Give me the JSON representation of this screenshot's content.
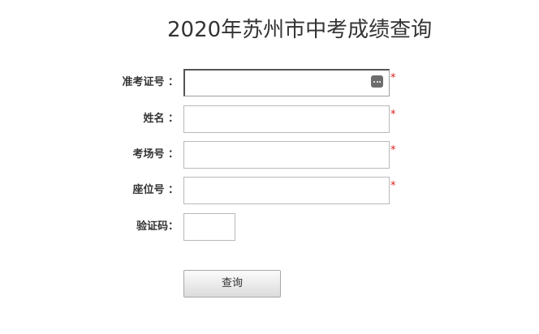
{
  "page": {
    "title": "2020年苏州市中考成绩查询"
  },
  "form": {
    "fields": [
      {
        "label": "准考证号 ：",
        "value": "",
        "required_mark": "*"
      },
      {
        "label": "姓名 ：",
        "value": "",
        "required_mark": "*"
      },
      {
        "label": "考场号 ：",
        "value": "",
        "required_mark": "*"
      },
      {
        "label": "座位号 ：",
        "value": "",
        "required_mark": "*"
      }
    ],
    "captcha": {
      "label": "验证码：",
      "value": ""
    },
    "submit_label": "查询"
  },
  "icons": {
    "password_manager": "keyboard-dots-icon"
  },
  "colors": {
    "required": "#e02020",
    "text": "#333333",
    "input_border": "#b9b9b9"
  }
}
